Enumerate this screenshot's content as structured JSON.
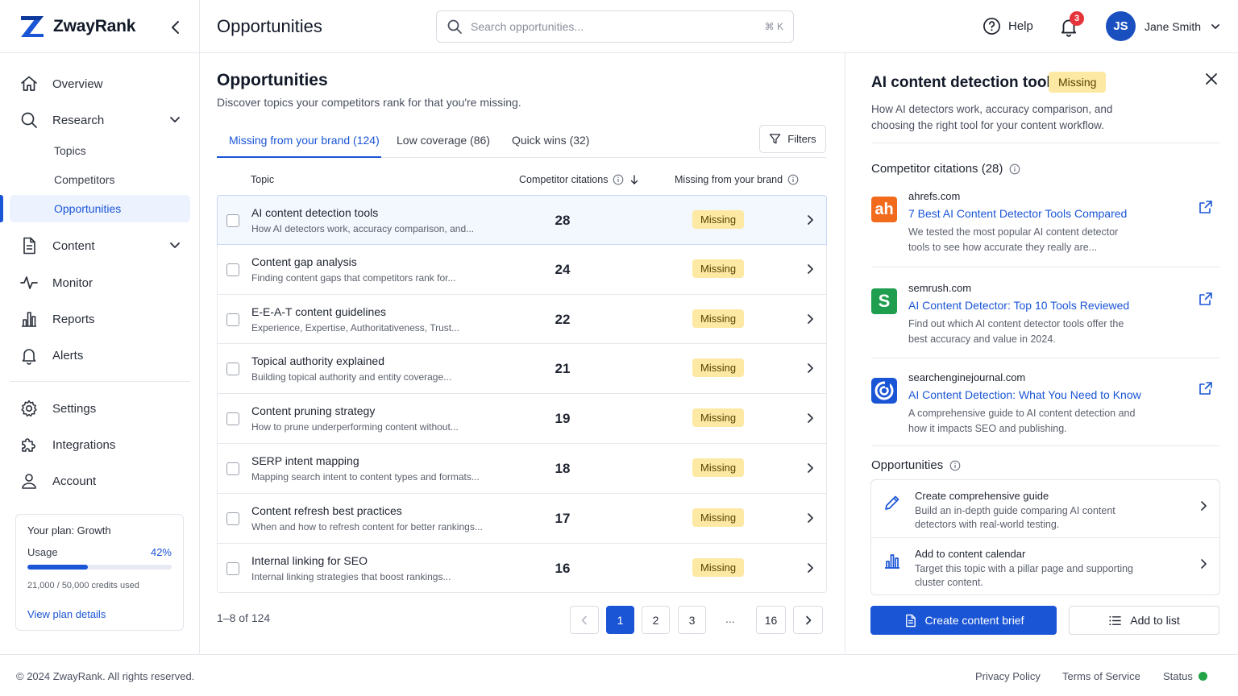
{
  "app": {
    "brand_name": "ZwayRank",
    "page_title": "Opportunities"
  },
  "header": {
    "search_placeholder": "Search opportunities...",
    "search_shortcut": "⌘ K",
    "help_label": "Help",
    "notification_count": "3",
    "user_initials": "JS",
    "user_name": "Jane Smith"
  },
  "sidebar": {
    "overview": "Overview",
    "research": "Research",
    "research_sub": [
      "Topics",
      "Competitors",
      "Opportunities"
    ],
    "content": "Content",
    "monitor": "Monitor",
    "reports": "Reports",
    "alerts": "Alerts",
    "settings": "Settings",
    "integrations": "Integrations",
    "account": "Account",
    "active_item": "Opportunities"
  },
  "plan": {
    "title": "Your plan: Growth",
    "usage_label": "Usage",
    "usage_pct_text": "42%",
    "usage_fraction": 0.42,
    "credits": "21,000 / 50,000 credits used",
    "link": "View plan details"
  },
  "main": {
    "title": "Opportunities",
    "subtitle": "Discover topics your competitors rank for that you're missing.",
    "tabs": [
      {
        "label": "Missing from your brand (124)",
        "active": true
      },
      {
        "label": "Low coverage (86)",
        "active": false
      },
      {
        "label": "Quick wins (32)",
        "active": false
      }
    ],
    "filters_label": "Filters",
    "columns": {
      "topic": "Topic",
      "citations": "Competitor citations",
      "missing": "Missing from your brand"
    },
    "rows": [
      {
        "title": "AI content detection tools",
        "desc": "How AI detectors work, accuracy comparison, and...",
        "count": "28",
        "status": "Missing"
      },
      {
        "title": "Content gap analysis",
        "desc": "Finding content gaps that competitors rank for...",
        "count": "24",
        "status": "Missing"
      },
      {
        "title": "E-E-A-T content guidelines",
        "desc": "Experience, Expertise, Authoritativeness, Trust...",
        "count": "22",
        "status": "Missing"
      },
      {
        "title": "Topical authority explained",
        "desc": "Building topical authority and entity coverage...",
        "count": "21",
        "status": "Missing"
      },
      {
        "title": "Content pruning strategy",
        "desc": "How to prune underperforming content without...",
        "count": "19",
        "status": "Missing"
      },
      {
        "title": "SERP intent mapping",
        "desc": "Mapping search intent to content types and formats...",
        "count": "18",
        "status": "Missing"
      },
      {
        "title": "Content refresh best practices",
        "desc": "When and how to refresh content for better rankings...",
        "count": "17",
        "status": "Missing"
      },
      {
        "title": "Internal linking for SEO",
        "desc": "Internal linking strategies that boost rankings...",
        "count": "16",
        "status": "Missing"
      }
    ],
    "page_info": "1–8 of 124",
    "pages": [
      "1",
      "2",
      "3",
      "...",
      "16"
    ]
  },
  "detail": {
    "title": "AI content detection tools",
    "badge": "Missing",
    "desc": "How AI detectors work, accuracy comparison, and choosing the right tool for your content workflow.",
    "citations_label": "Competitor citations (28)",
    "citations": [
      {
        "logo": "ah",
        "logo_color": "#f26b1d",
        "domain": "ahrefs.com",
        "title": "7 Best AI Content Detector Tools Compared",
        "text": "We tested the most popular AI content detector tools to see how accurate they really are..."
      },
      {
        "logo": "S",
        "logo_color": "#1f9e4f",
        "domain": "semrush.com",
        "title": "AI Content Detector: Top 10 Tools Reviewed",
        "text": "Find out which AI content detector tools offer the best accuracy and value in 2024."
      },
      {
        "logo": "",
        "logo_color": "#1a55d6",
        "domain": "searchenginejournal.com",
        "title": "AI Content Detection: What You Need to Know",
        "text": "A comprehensive guide to AI content detection and how it impacts SEO and publishing."
      }
    ],
    "opportunities_label": "Opportunities",
    "opportunities": [
      {
        "title": "Create comprehensive guide",
        "text": "Build an in-depth guide comparing AI content detectors with real-world testing."
      },
      {
        "title": "Add to content calendar",
        "text": "Target this topic with a pillar page and supporting cluster content."
      }
    ],
    "primary_button": "Create content brief",
    "secondary_button": "Add to list"
  },
  "footer": {
    "copyright": "© 2024 ZwayRank. All rights reserved.",
    "privacy": "Privacy Policy",
    "terms": "Terms of Service",
    "status": "Status"
  },
  "colors": {
    "accent": "#1a55d6",
    "badge_bg": "#fde9a3",
    "notification": "#e5343a",
    "status_ok": "#22a447"
  }
}
